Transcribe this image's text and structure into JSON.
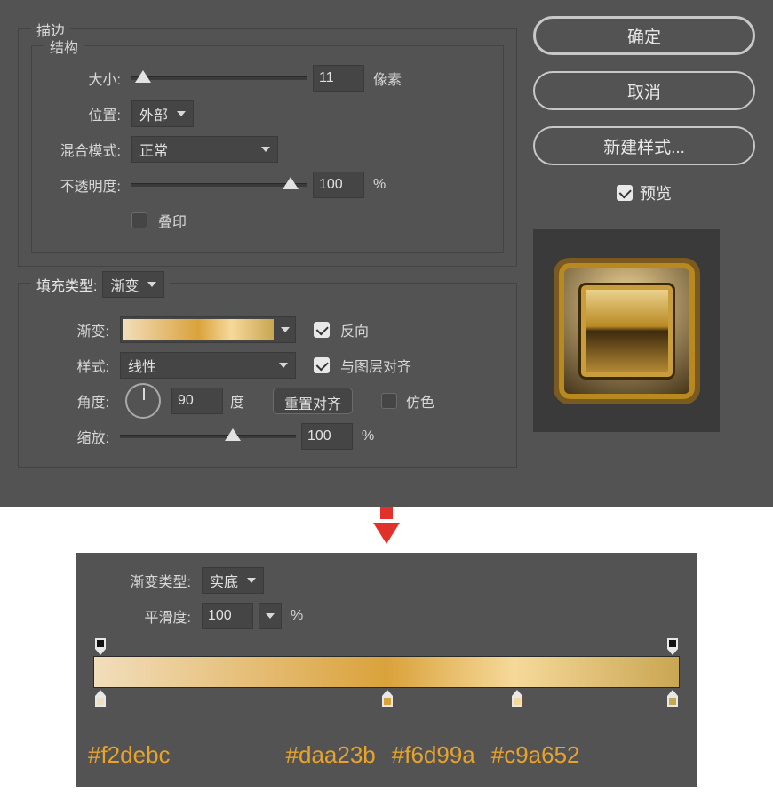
{
  "stroke": {
    "title": "描边",
    "structure": "结构",
    "sizeLabel": "大小:",
    "sizeValue": "11",
    "sizeUnit": "像素",
    "positionLabel": "位置:",
    "positionValue": "外部",
    "blendModeLabel": "混合模式:",
    "blendModeValue": "正常",
    "opacityLabel": "不透明度:",
    "opacityValue": "100",
    "opacityUnit": "%",
    "overprintLabel": "叠印"
  },
  "fill": {
    "fillTypeLabel": "填充类型:",
    "fillTypeValue": "渐变",
    "gradientLabel": "渐变:",
    "reverseLabel": "反向",
    "styleLabel": "样式:",
    "styleValue": "线性",
    "alignLabel": "与图层对齐",
    "angleLabel": "角度:",
    "angleValue": "90",
    "angleUnit": "度",
    "resetAlign": "重置对齐",
    "ditherLabel": "仿色",
    "scaleLabel": "缩放:",
    "scaleValue": "100",
    "scaleUnit": "%"
  },
  "buttons": {
    "ok": "确定",
    "cancel": "取消",
    "newStyle": "新建样式...",
    "previewLabel": "预览"
  },
  "gradient": {
    "typeLabel": "渐变类型:",
    "typeValue": "实底",
    "smoothLabel": "平滑度:",
    "smoothValue": "100",
    "smoothUnit": "%",
    "stops": {
      "c0": "#f2debc",
      "c1": "#daa23b",
      "c2": "#f6d99a",
      "c3": "#c9a652"
    }
  }
}
